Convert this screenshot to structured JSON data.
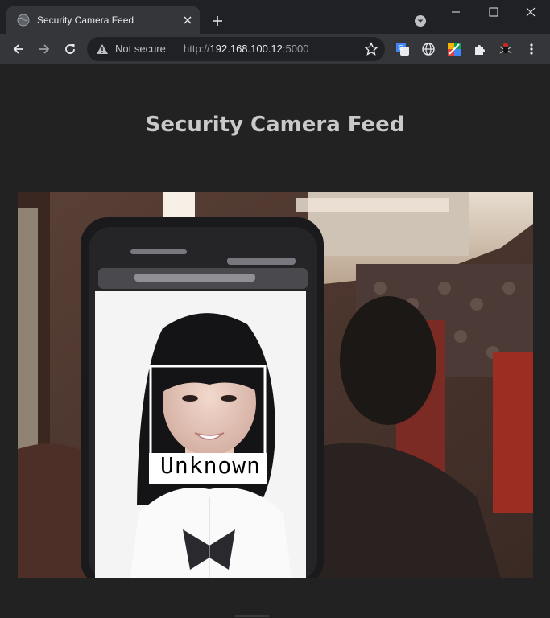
{
  "browser": {
    "tab_title": "Security Camera Feed",
    "omnibox": {
      "security_label": "Not secure",
      "url_scheme": "http://",
      "url_host": "192.168.100.12",
      "url_port": ":5000"
    },
    "icons": {
      "back": "back-arrow-icon",
      "forward": "forward-arrow-icon",
      "reload": "reload-icon",
      "bookmark": "star-icon",
      "extensions": "puzzle-icon",
      "menu": "kebab-menu-icon"
    }
  },
  "page": {
    "title": "Security Camera Feed",
    "feed": {
      "detection_label": "Unknown",
      "box_color": "#ffffff"
    }
  }
}
